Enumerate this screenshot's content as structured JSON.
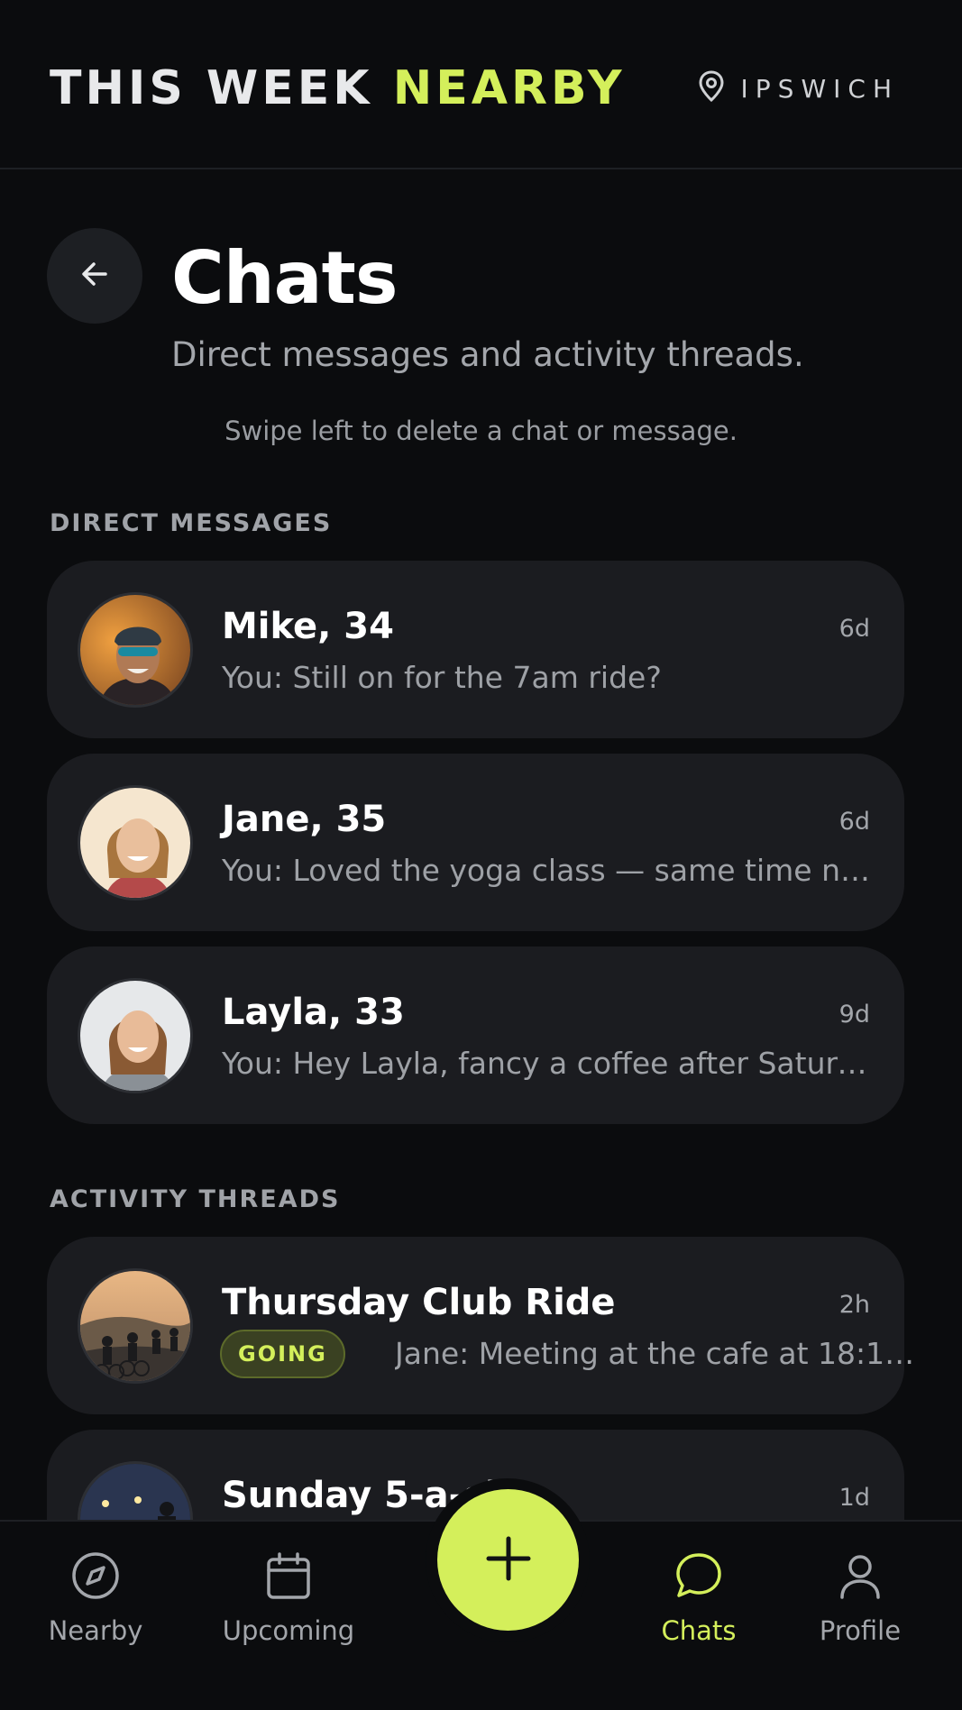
{
  "header": {
    "brand_main": "THIS WEEK ",
    "brand_accent": "NEARBY",
    "location": "IPSWICH",
    "location_icon": "map-pin-icon"
  },
  "page": {
    "back_icon": "arrow-left-icon",
    "title": "Chats",
    "subtitle": "Direct messages and activity threads.",
    "hint": "Swipe left to delete a chat or message."
  },
  "direct_messages": {
    "label": "DIRECT MESSAGES",
    "items": [
      {
        "name": "Mike, 34",
        "time": "6d",
        "preview": "You: Still on for the 7am ride?"
      },
      {
        "name": "Jane, 35",
        "time": "6d",
        "preview": "You: Loved the yoga class — same time ne..."
      },
      {
        "name": "Layla, 33",
        "time": "9d",
        "preview": "You: Hey Layla, fancy a coffee after Saturd..."
      }
    ]
  },
  "activity_threads": {
    "label": "ACTIVITY THREADS",
    "items": [
      {
        "name": "Thursday Club Ride",
        "time": "2h",
        "badge": "GOING",
        "preview": "Jane: Meeting at the cafe at 18:15 ..."
      },
      {
        "name": "Sunday 5-a-side",
        "time": "1d"
      }
    ]
  },
  "nav": {
    "items": [
      {
        "label": "Nearby",
        "icon": "compass-icon"
      },
      {
        "label": "Upcoming",
        "icon": "calendar-icon"
      },
      {
        "label": "Chats",
        "icon": "chat-bubble-icon"
      },
      {
        "label": "Profile",
        "icon": "user-icon"
      }
    ],
    "fab_icon": "plus-icon"
  },
  "colors": {
    "accent": "#d4ef5b",
    "background": "#0b0c0e",
    "card": "#1b1c20"
  }
}
